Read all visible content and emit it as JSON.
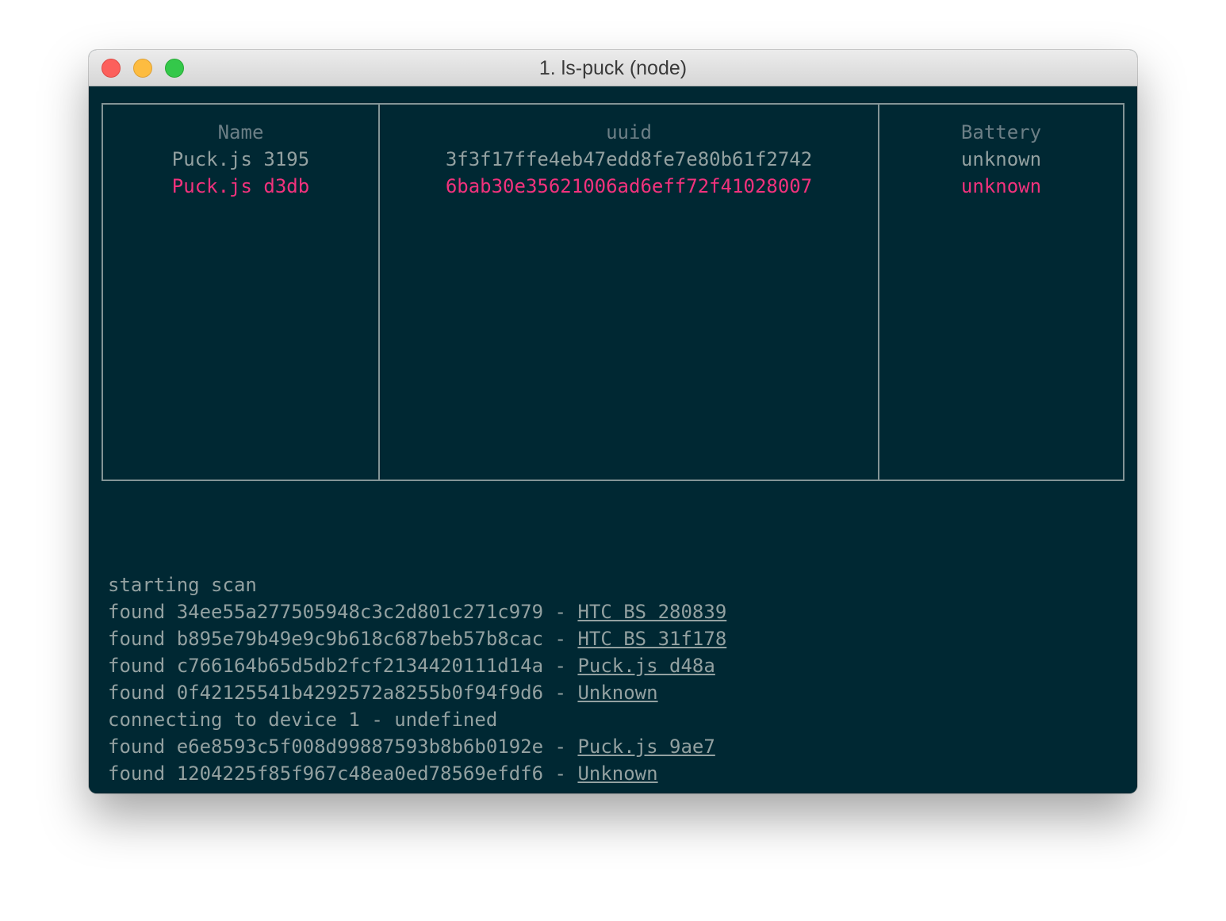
{
  "window": {
    "title": "1. ls-puck (node)"
  },
  "table": {
    "headers": [
      "Name",
      "uuid",
      "Battery"
    ],
    "rows": [
      {
        "name": "Puck.js 3195",
        "uuid": "3f3f17ffe4eb47edd8fe7e80b61f2742",
        "battery": "unknown",
        "selected": false
      },
      {
        "name": "Puck.js d3db",
        "uuid": "6bab30e35621006ad6eff72f41028007",
        "battery": "unknown",
        "selected": true
      }
    ]
  },
  "log": {
    "lines": [
      {
        "text": "starting scan"
      },
      {
        "prefix": "found ",
        "id": "34ee55a277505948c3c2d801c271c979",
        "sep": " - ",
        "link": "HTC BS 280839"
      },
      {
        "prefix": "found ",
        "id": "b895e79b49e9c9b618c687beb57b8cac",
        "sep": " - ",
        "link": "HTC BS 31f178"
      },
      {
        "prefix": "found ",
        "id": "c766164b65d5db2fcf2134420111d14a",
        "sep": " - ",
        "link": "Puck.js d48a"
      },
      {
        "prefix": "found ",
        "id": "0f42125541b4292572a8255b0f94f9d6",
        "sep": " - ",
        "link": "Unknown"
      },
      {
        "text": "connecting to device 1 - undefined"
      },
      {
        "prefix": "found ",
        "id": "e6e8593c5f008d99887593b8b6b0192e",
        "sep": " - ",
        "link": "Puck.js 9ae7"
      },
      {
        "prefix": "found ",
        "id": "1204225f85f967c48ea0ed78569efdf6",
        "sep": " - ",
        "link": "Unknown"
      }
    ]
  },
  "colors": {
    "terminal_bg": "#002833",
    "text": "#93a1a1",
    "header": "#6c7f86",
    "selected": "#f2327d",
    "border": "#839496"
  }
}
